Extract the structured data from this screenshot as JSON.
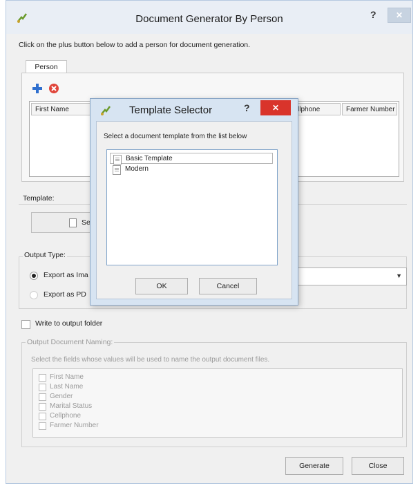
{
  "window": {
    "title": "Document Generator By Person",
    "help": "?",
    "close": "✕"
  },
  "instructions": "Click on the plus button below to add a person for document generation.",
  "person_tab": "Person",
  "persons_table": {
    "columns": [
      "First Name",
      "llphone",
      "Farmer Number"
    ]
  },
  "template_group": {
    "label": "Template:",
    "select_button": "Se"
  },
  "output_type": {
    "label": "Output Type:",
    "options": [
      {
        "label": "Export as Ima",
        "selected": true
      },
      {
        "label": "Export as PD",
        "selected": false
      }
    ]
  },
  "write_to_folder": "Write to output folder",
  "output_naming": {
    "label": "Output Document Naming:",
    "description": "Select the fields whose values will be used to name the output document files.",
    "fields": [
      "First Name",
      "Last Name",
      "Gender",
      "Marital Status",
      "Cellphone",
      "Farmer Number"
    ]
  },
  "buttons": {
    "generate": "Generate",
    "close": "Close"
  },
  "dialog": {
    "title": "Template Selector",
    "help": "?",
    "close": "✕",
    "instruction": "Select a document template from the list below",
    "templates": [
      {
        "label": "Basic Template",
        "selected": true
      },
      {
        "label": "Modern",
        "selected": false
      }
    ],
    "ok": "OK",
    "cancel": "Cancel"
  }
}
